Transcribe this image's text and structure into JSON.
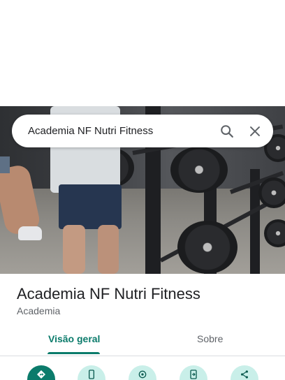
{
  "search": {
    "query": "Academia NF Nutri Fitness",
    "search_icon": "search-icon",
    "close_icon": "close-icon"
  },
  "place": {
    "title": "Academia NF Nutri Fitness",
    "category": "Academia"
  },
  "tabs": [
    {
      "label": "Visão geral",
      "selected": true
    },
    {
      "label": "Sobre",
      "selected": false
    }
  ],
  "actions": [
    {
      "icon": "directions-icon"
    },
    {
      "icon": "phone-icon"
    },
    {
      "icon": "location-icon"
    },
    {
      "icon": "send-to-phone-icon"
    },
    {
      "icon": "share-icon"
    }
  ],
  "colors": {
    "accent": "#0b7b6b",
    "accent_light": "#c9efe9",
    "text_primary": "#202124",
    "text_secondary": "#5f6368"
  }
}
